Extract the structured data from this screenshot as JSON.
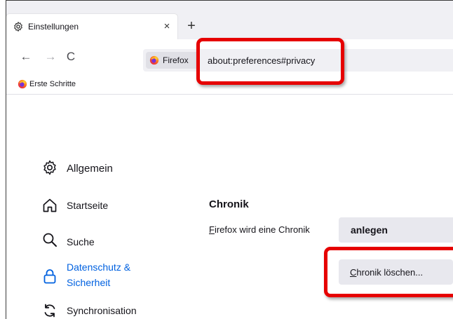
{
  "tab": {
    "title": "Einstellungen",
    "close": "×"
  },
  "tabstrip": {
    "new_tab": "+"
  },
  "navbar": {
    "back": "←",
    "forward": "→",
    "reload": "C"
  },
  "urlbar": {
    "identity_label": "Firefox",
    "url": "about:preferences#privacy"
  },
  "bookmarks": [
    {
      "label": "Erste Schritte"
    }
  ],
  "sidebar": {
    "items": [
      {
        "label": "Allgemein",
        "icon": "gear-icon"
      },
      {
        "label": "Startseite",
        "icon": "home-icon"
      },
      {
        "label": "Suche",
        "icon": "search-icon"
      },
      {
        "label": "Datenschutz & Sicherheit",
        "icon": "lock-icon",
        "selected": true
      },
      {
        "label": "Synchronisation",
        "icon": "sync-icon"
      }
    ]
  },
  "history": {
    "title": "Chronik",
    "label_key": "F",
    "label_rest": "irefox wird eine Chronik",
    "select_value": "anlegen",
    "clear_key": "C",
    "clear_rest": "hronik löschen..."
  },
  "colors": {
    "accent": "#0061e0",
    "highlight": "#e60000",
    "chrome": "#f0f0f4"
  }
}
